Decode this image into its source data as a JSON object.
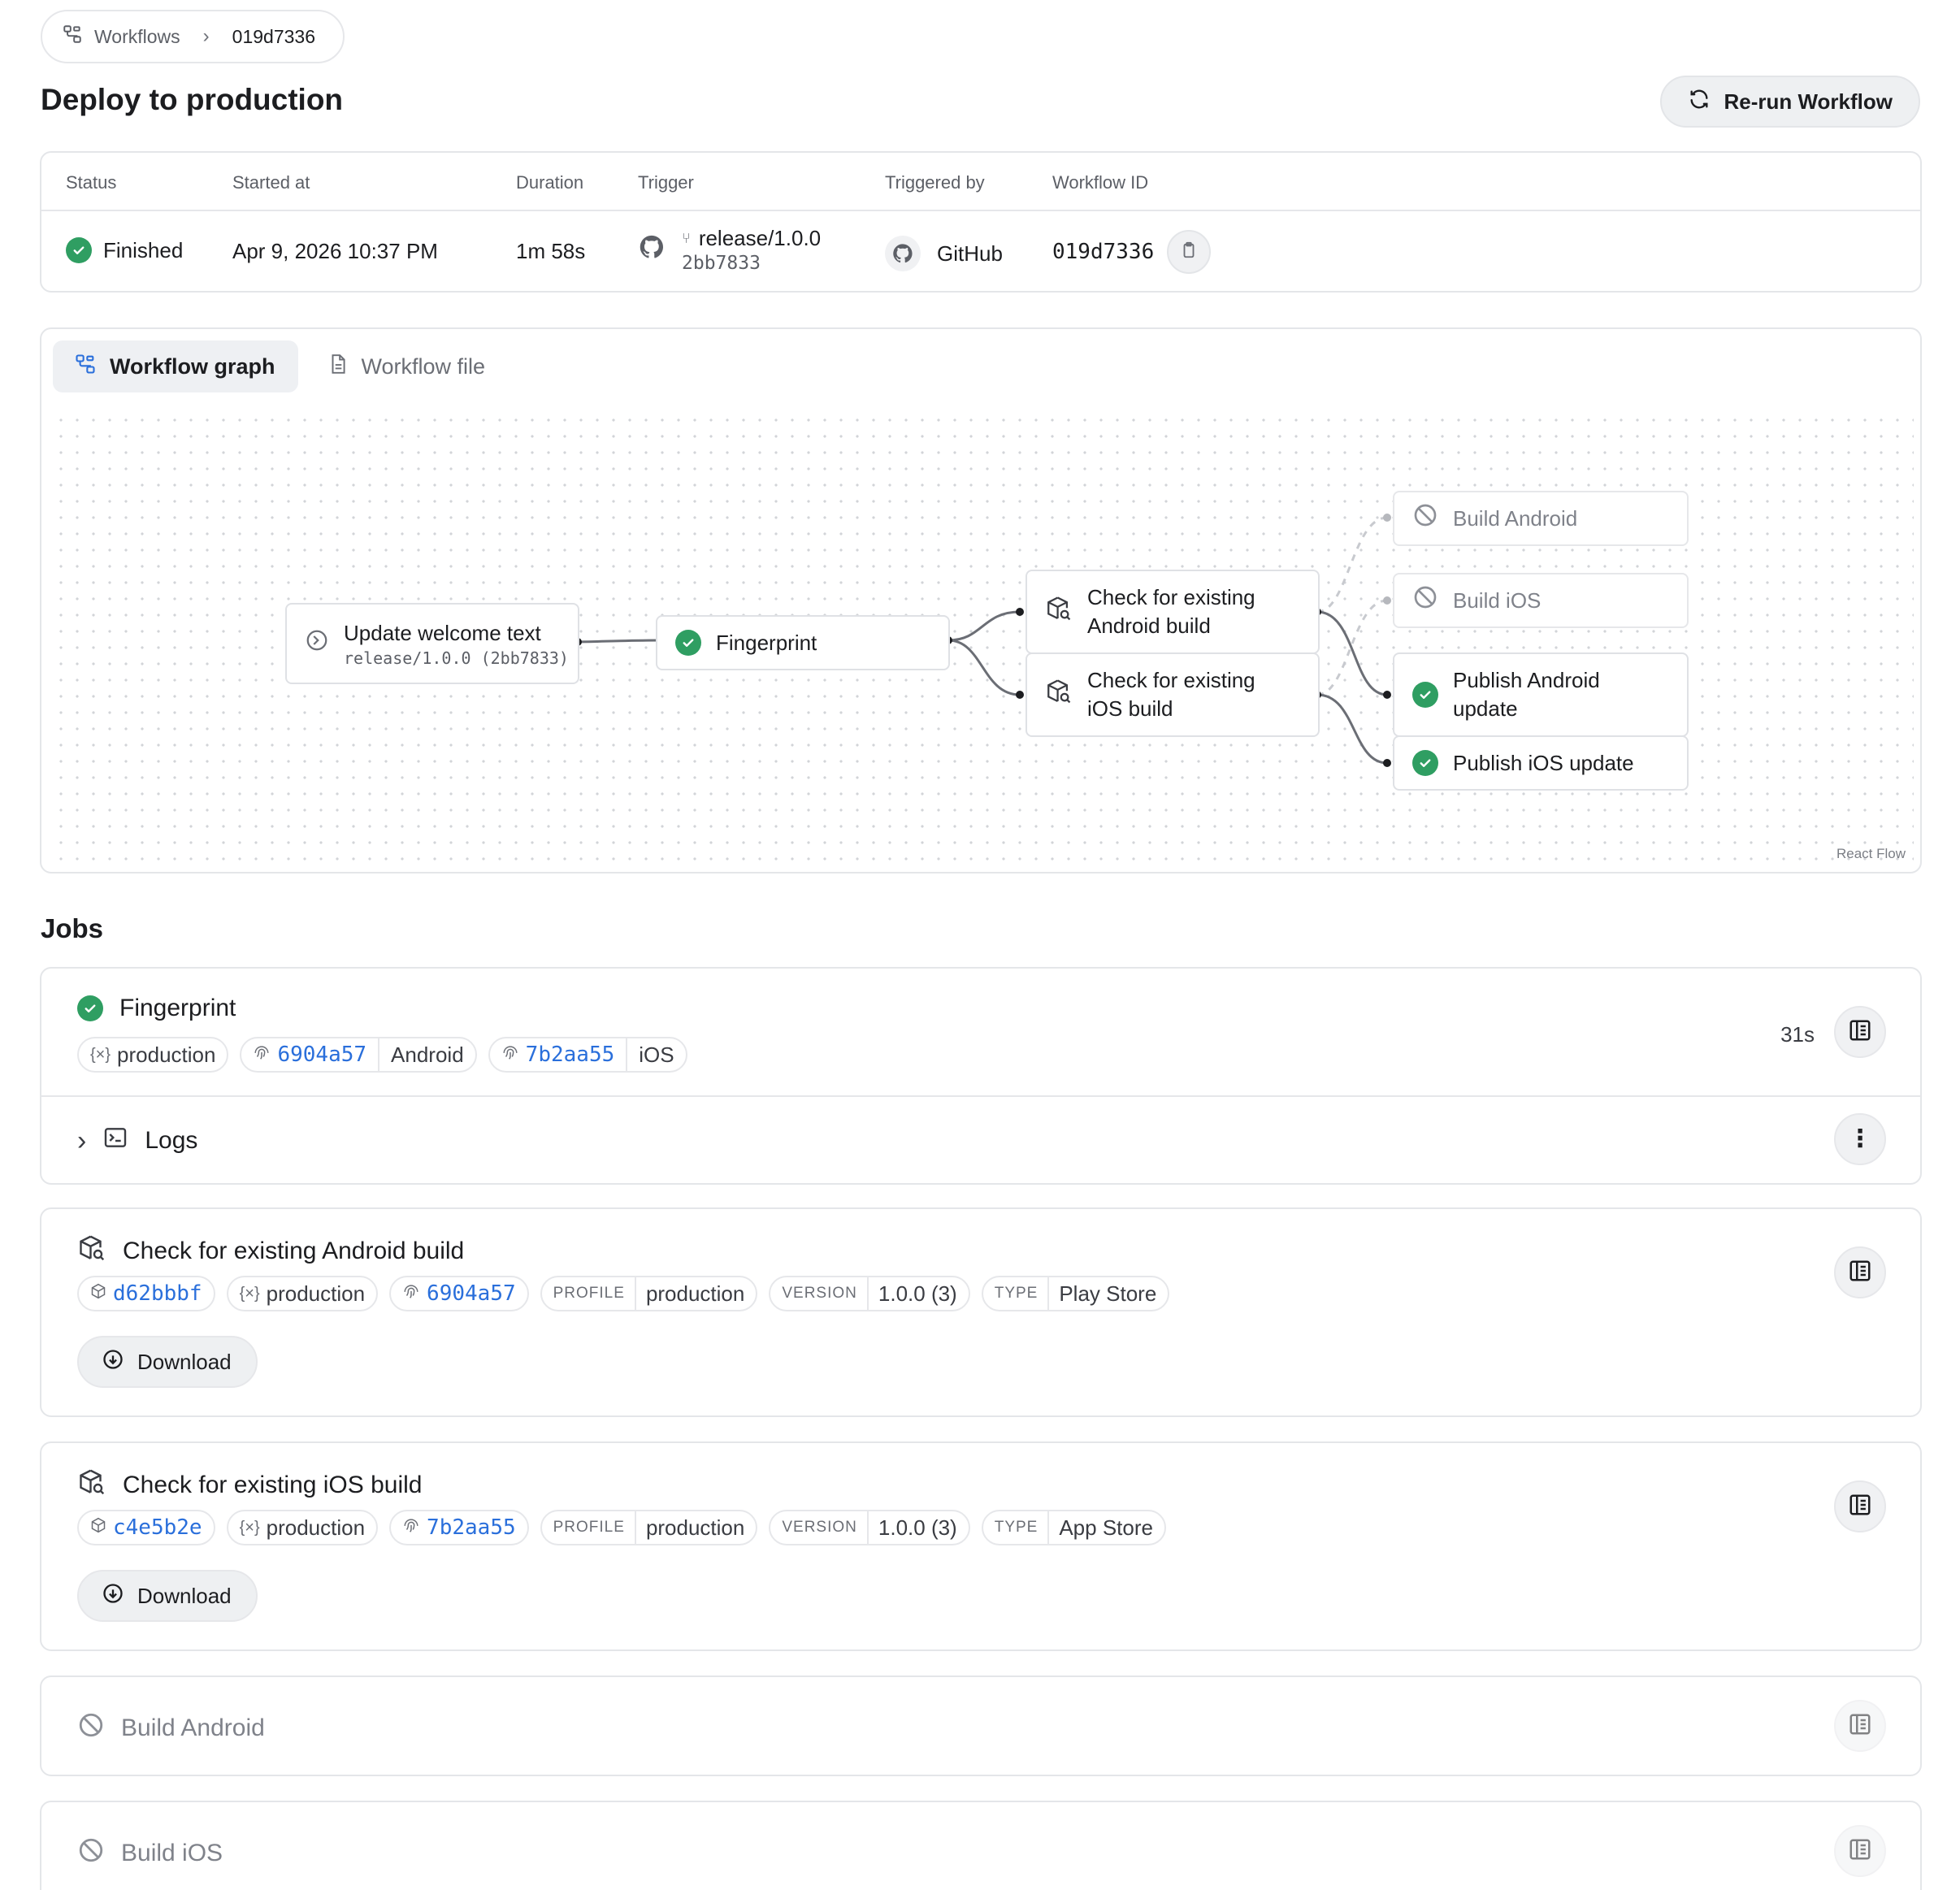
{
  "breadcrumb": {
    "root": "Workflows",
    "current": "019d7336"
  },
  "page": {
    "title": "Deploy to production",
    "rerun_label": "Re-run Workflow"
  },
  "summary": {
    "headers": {
      "status": "Status",
      "started_at": "Started at",
      "duration": "Duration",
      "trigger": "Trigger",
      "triggered_by": "Triggered by",
      "workflow_id": "Workflow ID"
    },
    "status": "Finished",
    "started_at": "Apr 9, 2026 10:37 PM",
    "duration": "1m 58s",
    "trigger_branch": "release/1.0.0",
    "trigger_commit": "2bb7833",
    "triggered_by": "GitHub",
    "workflow_id": "019d7336"
  },
  "graph": {
    "tabs": [
      {
        "label": "Workflow graph",
        "active": true
      },
      {
        "label": "Workflow file",
        "active": false
      }
    ],
    "attribution": "React Flow",
    "nodes": {
      "update": {
        "title": "Update welcome text",
        "subtitle": "release/1.0.0 (2bb7833)"
      },
      "fingerprint": {
        "title": "Fingerprint",
        "status": "success"
      },
      "check_android": {
        "line1": "Check for existing",
        "line2": "Android build"
      },
      "check_ios": {
        "line1": "Check for existing",
        "line2": "iOS build"
      },
      "build_android": {
        "title": "Build Android",
        "status": "skipped"
      },
      "build_ios": {
        "title": "Build iOS",
        "status": "skipped"
      },
      "publish_android": {
        "line1": "Publish Android",
        "line2": "update",
        "status": "success"
      },
      "publish_ios": {
        "title": "Publish iOS update",
        "status": "success"
      }
    }
  },
  "jobs": {
    "title": "Jobs",
    "fingerprint": {
      "title": "Fingerprint",
      "duration": "31s",
      "env": "production",
      "android_hash": "6904a57",
      "android_label": "Android",
      "ios_hash": "7b2aa55",
      "ios_label": "iOS",
      "logs_label": "Logs"
    },
    "check_android": {
      "title": "Check for existing Android build",
      "build_id": "d62bbbf",
      "env": "production",
      "fingerprint": "6904a57",
      "profile_key": "PROFILE",
      "profile_val": "production",
      "version_key": "VERSION",
      "version_val": "1.0.0 (3)",
      "type_key": "TYPE",
      "type_val": "Play Store",
      "download_label": "Download"
    },
    "check_ios": {
      "title": "Check for existing iOS build",
      "build_id": "c4e5b2e",
      "env": "production",
      "fingerprint": "7b2aa55",
      "profile_key": "PROFILE",
      "profile_val": "production",
      "version_key": "VERSION",
      "version_val": "1.0.0 (3)",
      "type_key": "TYPE",
      "type_val": "App Store",
      "download_label": "Download"
    },
    "build_android": {
      "title": "Build Android"
    },
    "build_ios": {
      "title": "Build iOS"
    }
  },
  "colors": {
    "success": "#2f9e62",
    "link": "#2a6fdb",
    "muted": "#7f828a"
  }
}
